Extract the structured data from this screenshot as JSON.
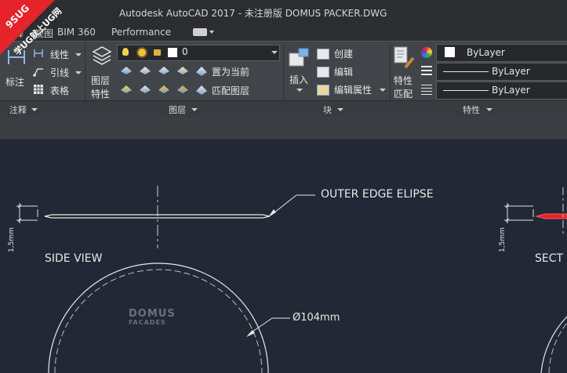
{
  "window": {
    "title": "Autodesk AutoCAD 2017 - 未注册版    DOMUS PACKER.DWG"
  },
  "watermark": {
    "line1": "9SUG",
    "line2": "学UG就上UG网"
  },
  "tabs": [
    "注释",
    "视图",
    "BIM 360",
    "Performance"
  ],
  "ribbon": {
    "annotate": {
      "large_label": "标注",
      "items": [
        "线性",
        "引线",
        "表格"
      ],
      "panel": "注释"
    },
    "layers": {
      "large_label_1": "图层",
      "large_label_2": "特性",
      "current_layer": "0",
      "set_current": "置为当前",
      "match_layer": "匹配图层",
      "panel": "图层"
    },
    "block": {
      "insert": "插入",
      "create": "创建",
      "edit": "编辑",
      "edit_attr": "编辑属性",
      "panel": "块"
    },
    "properties": {
      "match_label_1": "特性",
      "match_label_2": "匹配",
      "color": "ByLayer",
      "linetype": "ByLayer",
      "lineweight": "ByLayer",
      "panel": "特性"
    }
  },
  "drawing": {
    "outer_edge_label": "OUTER EDGE ELIPSE",
    "side_view": "SIDE VIEW",
    "section_label": "SECT",
    "diameter": "Ø104mm",
    "dim_left": "1,5mm",
    "dim_right": "1,5mm",
    "logo_1": "DOMUS",
    "logo_2": "FACADES"
  },
  "colors": {
    "canvas_bg": "#222835",
    "ribbon_bg": "#414449",
    "accent_red": "#e4232a"
  }
}
